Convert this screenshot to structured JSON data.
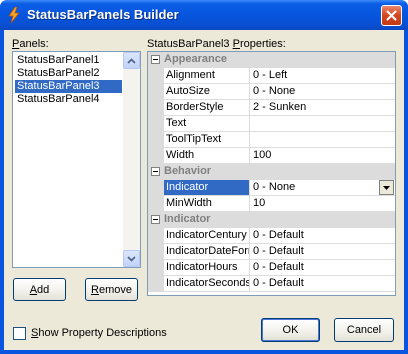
{
  "window": {
    "title": "StatusBarPanels Builder"
  },
  "panels": {
    "label_pre": "",
    "label_access": "P",
    "label_post": "anels:",
    "items": [
      "StatusBarPanel1",
      "StatusBarPanel2",
      "StatusBarPanel3",
      "StatusBarPanel4"
    ],
    "selected_index": 2
  },
  "buttons": {
    "add_access": "A",
    "add_rest": "dd",
    "remove_access": "R",
    "remove_rest": "emove",
    "ok": "OK",
    "cancel": "Cancel"
  },
  "properties": {
    "label_pre": "StatusBarPanel3 ",
    "label_access": "P",
    "label_post": "roperties:",
    "categories": [
      {
        "name": "Appearance",
        "rows": [
          {
            "name": "Alignment",
            "value": "0 - Left"
          },
          {
            "name": "AutoSize",
            "value": "0 - None"
          },
          {
            "name": "BorderStyle",
            "value": "2 - Sunken"
          },
          {
            "name": "Text",
            "value": ""
          },
          {
            "name": "ToolTipText",
            "value": ""
          },
          {
            "name": "Width",
            "value": "100"
          }
        ]
      },
      {
        "name": "Behavior",
        "rows": [
          {
            "name": "Indicator",
            "value": "0 - None",
            "selected": true,
            "dropdown": true
          },
          {
            "name": "MinWidth",
            "value": "10"
          }
        ]
      },
      {
        "name": "Indicator",
        "rows": [
          {
            "name": "IndicatorCentury",
            "value": "0 - Default"
          },
          {
            "name": "IndicatorDateFormat",
            "value": "0 - Default"
          },
          {
            "name": "IndicatorHours",
            "value": "0 - Default"
          },
          {
            "name": "IndicatorSeconds",
            "value": "0 - Default"
          }
        ]
      }
    ]
  },
  "options": {
    "show_descriptions_access": "S",
    "show_descriptions_rest": "how Property Descriptions",
    "show_descriptions_checked": false
  },
  "colors": {
    "titlebar": "#0754dd",
    "selection": "#316ac5",
    "dialog_face": "#ece9d8",
    "category_bg": "#dcdcdc"
  },
  "icons": {
    "app": "lightning-bolt-icon",
    "close": "close-icon",
    "scroll_up": "chevron-up-icon",
    "scroll_down": "chevron-down-icon",
    "dropdown": "triangle-down-icon"
  }
}
